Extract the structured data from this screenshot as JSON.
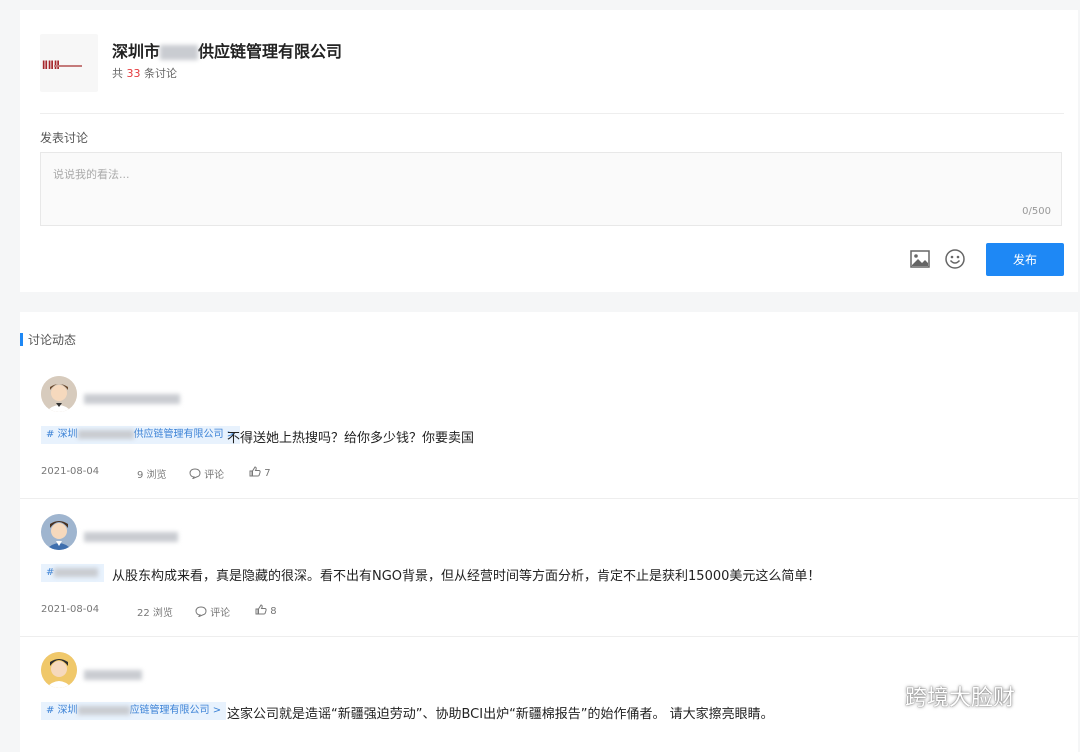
{
  "company": {
    "name_prefix": "深圳市",
    "name_suffix": "供应链管理有限公司",
    "count_prefix": "共",
    "count": "33",
    "count_suffix": "条讨论"
  },
  "composer": {
    "label": "发表讨论",
    "placeholder": "说说我的看法...",
    "char_counter": "0/500",
    "publish_label": "发布"
  },
  "feed": {
    "title": "讨论动态",
    "posts": [
      {
        "tag_prefix": "# 深圳",
        "tag_suffix": "供应链管理有限公司 >",
        "text": "不得送她上热搜吗？给你多少钱？你要卖国",
        "date": "2021-08-04",
        "views": "9 浏览",
        "comment_label": "评论",
        "likes": "7"
      },
      {
        "tag_prefix": "#",
        "tag_suffix": "",
        "text": "从股东构成来看，真是隐藏的很深。看不出有NGO背景，但从经营时间等方面分析，肯定不止是获利15000美元这么简单！",
        "date": "2021-08-04",
        "views": "22 浏览",
        "comment_label": "评论",
        "likes": "8"
      },
      {
        "tag_prefix": "# 深圳",
        "tag_suffix": "应链管理有限公司 >",
        "text": "这家公司就是造谣“新疆强迫劳动”、协助BCI出炉“新疆棉报告”的始作俑者。 请大家擦亮眼睛。"
      }
    ]
  },
  "watermark": "跨境大脸财",
  "colors": {
    "accent": "#1e88f5",
    "count_red": "#e4393c",
    "tag_bg": "#e8f2fd",
    "tag_text": "#3b82d6"
  },
  "icons": [
    "image-icon",
    "emoji-icon",
    "comment-icon",
    "thumbs-up-icon",
    "wechat-icon"
  ]
}
